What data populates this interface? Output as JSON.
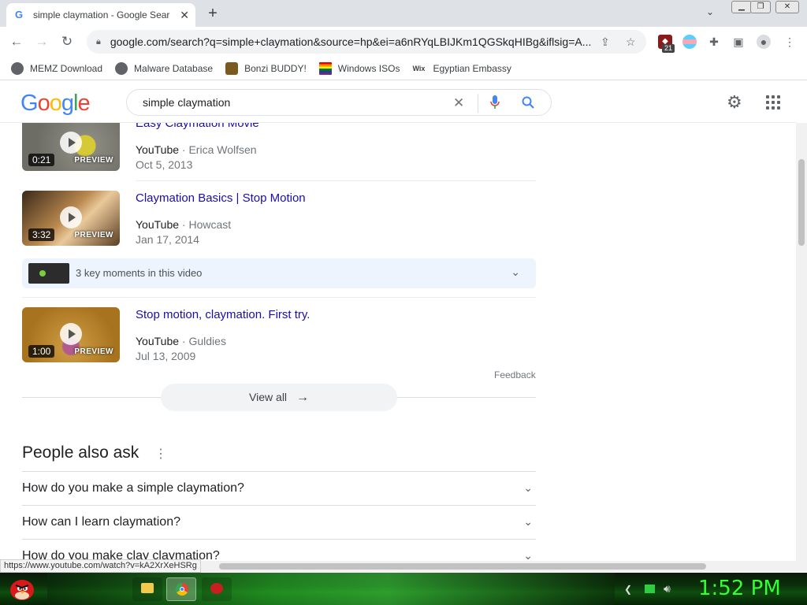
{
  "browser": {
    "tab_title": "simple claymation - Google Sear",
    "tab_favicon": "G",
    "url": "google.com/search?q=simple+claymation&source=hp&ei=a6nRYqLBIJKm1QGSkqHIBg&iflsig=A...",
    "extension_badge": "21",
    "status_url": "https://www.youtube.com/watch?v=kA2XrXeHSRg"
  },
  "bookmarks": [
    {
      "label": "MEMZ Download",
      "icon": "globe-icon"
    },
    {
      "label": "Malware Database",
      "icon": "globe-icon"
    },
    {
      "label": "Bonzi BUDDY!",
      "icon": "bonzi-icon"
    },
    {
      "label": "Windows ISOs",
      "icon": "windows-flag-icon"
    },
    {
      "label": "Egyptian Embassy",
      "icon": "wix-icon"
    }
  ],
  "google": {
    "logo": [
      "G",
      "o",
      "o",
      "g",
      "l",
      "e"
    ],
    "query": "simple claymation"
  },
  "videos": [
    {
      "title": "Easy Claymation Movie",
      "source": "YouTube",
      "channel": "Erica Wolfsen",
      "date": "Oct 5, 2013",
      "duration": "0:21",
      "preview": "PREVIEW"
    },
    {
      "title": "Claymation Basics | Stop Motion",
      "source": "YouTube",
      "channel": "Howcast",
      "date": "Jan 17, 2014",
      "duration": "3:32",
      "preview": "PREVIEW"
    },
    {
      "title": "Stop motion, claymation. First try.",
      "source": "YouTube",
      "channel": "Guldies",
      "date": "Jul 13, 2009",
      "duration": "1:00",
      "preview": "PREVIEW"
    }
  ],
  "separator": " · ",
  "key_moments": "3 key moments in this video",
  "feedback": "Feedback",
  "view_all": "View all",
  "paa": {
    "title": "People also ask",
    "questions": [
      "How do you make a simple claymation?",
      "How can I learn claymation?",
      "How do you make clay claymation?"
    ]
  },
  "taskbar": {
    "clock": "1:52 PM"
  }
}
